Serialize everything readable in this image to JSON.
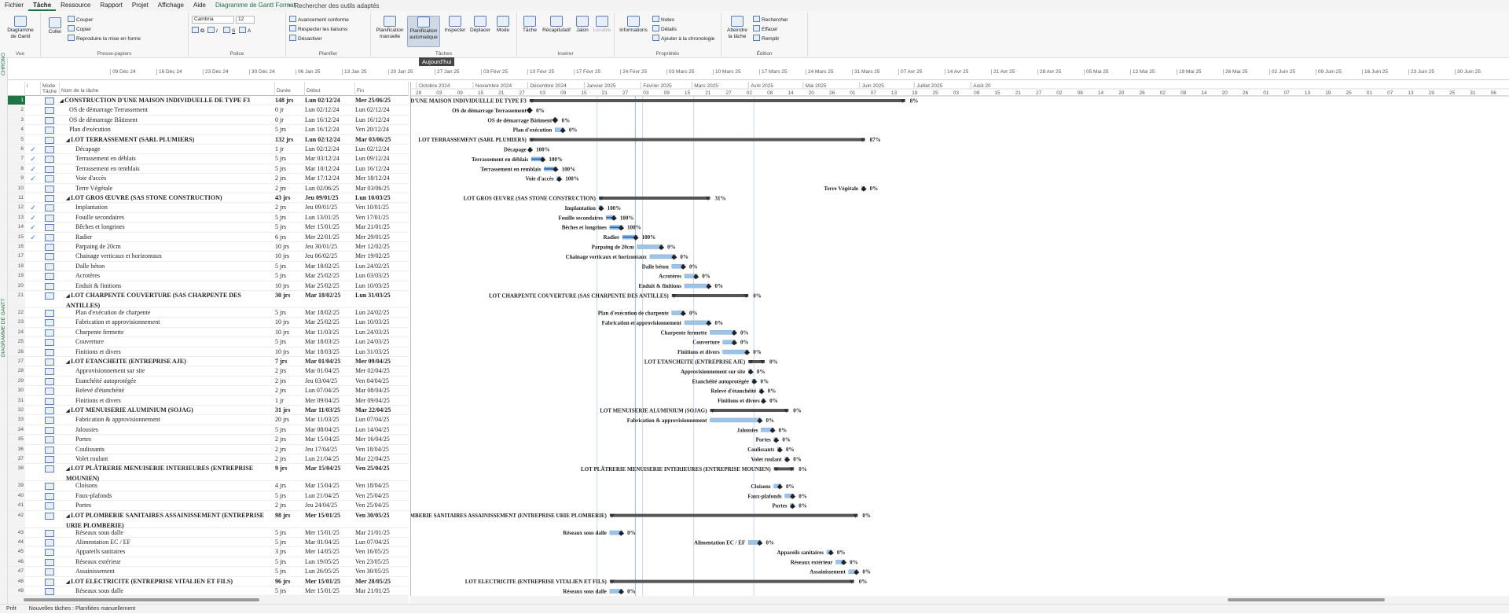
{
  "menu": [
    "Fichier",
    "Tâche",
    "Ressource",
    "Rapport",
    "Projet",
    "Affichage",
    "Aide",
    "Diagramme de Gantt Format"
  ],
  "search_placeholder": "Rechercher des outils adaptés",
  "ribbon": {
    "vue": {
      "label": "Vue",
      "gantt_btn": "Diagramme de Gantt"
    },
    "presse": {
      "label": "Presse-papiers",
      "coller": "Coller",
      "couper": "Couper",
      "copier": "Copier",
      "reproduire": "Reproduire la mise en forme"
    },
    "police": {
      "label": "Police",
      "font": "Cambria",
      "size": "12"
    },
    "planifier": {
      "label": "Planifier",
      "avancement": "Avancement conforme",
      "respecter": "Respecter les liaisons",
      "desactiver": "Désactiver"
    },
    "taches": {
      "label": "Tâches",
      "manuelle": "Planification manuelle",
      "auto": "Planification automatique",
      "inspecter": "Inspecter",
      "deplacer": "Déplacer",
      "mode": "Mode"
    },
    "inserer": {
      "label": "Insérer",
      "tache": "Tâche",
      "recap": "Récapitulatif",
      "jalon": "Jalon",
      "livrable": "Livrable"
    },
    "proprietes": {
      "label": "Propriétés",
      "informations": "Informations",
      "notes": "Notes",
      "details": "Détails",
      "ajouter": "Ajouter à la chronologie"
    },
    "edition": {
      "label": "Édition",
      "atteindre": "Atteindre la tâche",
      "rechercher": "Rechercher",
      "effacer": "Effacer",
      "remplir": "Remplir"
    }
  },
  "today_tooltip": "Aujourd'hui",
  "side_labels": {
    "chrono": "CHRONO",
    "gantt": "DIAGRAMME DE GANTT"
  },
  "timeline_labels": [
    "09 Déc 24",
    "16 Déc 24",
    "23 Déc 24",
    "30 Déc 24",
    "06 Jan 25",
    "13 Jan 25",
    "20 Jan 25",
    "27 Jan 25",
    "03 Févr 25",
    "10 Févr 25",
    "17 Févr 25",
    "24 Févr 25",
    "03 Mars 25",
    "10 Mars 25",
    "17 Mars 25",
    "24 Mars 25",
    "31 Mars 25",
    "07 Avr 25",
    "14 Avr 25",
    "21 Avr 25",
    "28 Avr 25",
    "05 Mai 25",
    "12 Mai 25",
    "19 Mai 25",
    "26 Mai 25",
    "02 Juin 25",
    "09 Juin 25",
    "16 Juin 25",
    "23 Juin 25",
    "30 Juin 25"
  ],
  "columns": {
    "info": "i",
    "mode": "Mode Tâche",
    "name": "Nom de la tâche",
    "dur": "Durée",
    "deb": "Début",
    "fin": "Fin"
  },
  "months": [
    "Octobre 2024",
    "Novembre 2024",
    "Décembre 2024",
    "Janvier 2025",
    "Février 2025",
    "Mars 2025",
    "Avril 2025",
    "Mai 2025",
    "Juin 2025",
    "Juillet 2025",
    "Août 20"
  ],
  "days": [
    "28",
    "03",
    "09",
    "15",
    "21",
    "27",
    "03",
    "09",
    "15",
    "21",
    "27",
    "03",
    "09",
    "15",
    "21",
    "27",
    "02",
    "08",
    "14",
    "20",
    "26",
    "01",
    "07",
    "13",
    "19",
    "25",
    "03",
    "09",
    "15",
    "21",
    "27",
    "02",
    "08",
    "14",
    "20",
    "26",
    "02",
    "08",
    "14",
    "20",
    "26",
    "01",
    "07",
    "13",
    "19",
    "25",
    "01",
    "07",
    "13",
    "19",
    "25",
    "31",
    "06",
    "12"
  ],
  "tasks": [
    {
      "id": "1",
      "name": "CONSTRUCTION D'UNE MAISON INDIVIDUELLE DE TYPE F3",
      "dur": "148 jrs",
      "deb": "Lun 02/12/24",
      "fin": "Mer 25/06/25",
      "summary": true,
      "level": 0,
      "done": "",
      "pct": "8%",
      "label": "CONSTRUCTION D'UNE MAISON INDIVIDUELLE DE TYPE F3"
    },
    {
      "id": "2",
      "name": "OS de démarrage Terrassement",
      "dur": "0 jr",
      "deb": "Lun 02/12/24",
      "fin": "Lun 02/12/24",
      "level": 1,
      "done": "",
      "pct": "0%",
      "label": "OS de démarrage Terrassement"
    },
    {
      "id": "3",
      "name": "OS de démarrage Bâtiment",
      "dur": "0 jr",
      "deb": "Lun 16/12/24",
      "fin": "Lun 16/12/24",
      "level": 1,
      "done": "",
      "pct": "0%",
      "label": "OS de démarrage Bâtiment"
    },
    {
      "id": "4",
      "name": "Plan d'exécution",
      "dur": "5 jrs",
      "deb": "Lun 16/12/24",
      "fin": "Ven 20/12/24",
      "level": 1,
      "done": "",
      "pct": "0%",
      "label": "Plan d'exécution"
    },
    {
      "id": "5",
      "name": "LOT TERRASSEMENT (SARL PLUMIERS)",
      "dur": "132 jrs",
      "deb": "Lun 02/12/24",
      "fin": "Mar 03/06/25",
      "summary": true,
      "level": 1,
      "done": "",
      "pct": "87%",
      "label": "LOT TERRASSEMENT (SARL PLUMIERS)"
    },
    {
      "id": "6",
      "name": "Décapage",
      "dur": "1 jr",
      "deb": "Lun 02/12/24",
      "fin": "Lun 02/12/24",
      "level": 2,
      "done": "✓",
      "pct": "100%",
      "label": "Décapage"
    },
    {
      "id": "7",
      "name": "Terrassement en déblais",
      "dur": "5 jrs",
      "deb": "Mar 03/12/24",
      "fin": "Lun 09/12/24",
      "level": 2,
      "done": "✓",
      "pct": "100%",
      "label": "Terrassement en déblais"
    },
    {
      "id": "8",
      "name": "Terrassement en remblais",
      "dur": "5 jrs",
      "deb": "Mar 10/12/24",
      "fin": "Lun 16/12/24",
      "level": 2,
      "done": "✓",
      "pct": "100%",
      "label": "Terrassement en remblais"
    },
    {
      "id": "9",
      "name": "Voie d'accès",
      "dur": "2 jrs",
      "deb": "Mar 17/12/24",
      "fin": "Mer 18/12/24",
      "level": 2,
      "done": "✓",
      "pct": "100%",
      "label": "Voie d'accès"
    },
    {
      "id": "10",
      "name": "Terre Végétale",
      "dur": "2 jrs",
      "deb": "Lun 02/06/25",
      "fin": "Mar 03/06/25",
      "level": 2,
      "done": "",
      "pct": "0%",
      "label": "Terre Végétale"
    },
    {
      "id": "11",
      "name": "LOT GROS ŒUVRE (SAS STONE CONSTRUCTION)",
      "dur": "43 jrs",
      "deb": "Jeu 09/01/25",
      "fin": "Lun 10/03/25",
      "summary": true,
      "level": 1,
      "done": "",
      "pct": "31%",
      "label": "LOT GROS ŒUVRE (SAS STONE CONSTRUCTION)"
    },
    {
      "id": "12",
      "name": "Implantation",
      "dur": "2 jrs",
      "deb": "Jeu 09/01/25",
      "fin": "Ven 10/01/25",
      "level": 2,
      "done": "✓",
      "pct": "100%",
      "label": "Implantation"
    },
    {
      "id": "13",
      "name": "Fouille secondaires",
      "dur": "5 jrs",
      "deb": "Lun 13/01/25",
      "fin": "Ven 17/01/25",
      "level": 2,
      "done": "✓",
      "pct": "100%",
      "label": "Fouille secondaires"
    },
    {
      "id": "14",
      "name": "Bêches et longrines",
      "dur": "5 jrs",
      "deb": "Mer 15/01/25",
      "fin": "Mar 21/01/25",
      "level": 2,
      "done": "✓",
      "pct": "100%",
      "label": "Bêches et longrines"
    },
    {
      "id": "15",
      "name": "Radier",
      "dur": "6 jrs",
      "deb": "Mer 22/01/25",
      "fin": "Mer 29/01/25",
      "level": 2,
      "done": "✓",
      "pct": "100%",
      "label": "Radier"
    },
    {
      "id": "16",
      "name": "Parpaing de 20cm",
      "dur": "10 jrs",
      "deb": "Jeu 30/01/25",
      "fin": "Mer 12/02/25",
      "level": 2,
      "done": "",
      "pct": "0%",
      "label": "Parpaing de 20cm"
    },
    {
      "id": "17",
      "name": "Chainage verticaux et horizontaux",
      "dur": "10 jrs",
      "deb": "Jeu 06/02/25",
      "fin": "Mer 19/02/25",
      "level": 2,
      "done": "",
      "pct": "0%",
      "label": "Chainage verticaux et horizontaux"
    },
    {
      "id": "18",
      "name": "Dalle béton",
      "dur": "5 jrs",
      "deb": "Mar 18/02/25",
      "fin": "Lun 24/02/25",
      "level": 2,
      "done": "",
      "pct": "0%",
      "label": "Dalle béton"
    },
    {
      "id": "19",
      "name": "Acrotères",
      "dur": "5 jrs",
      "deb": "Mar 25/02/25",
      "fin": "Lun 03/03/25",
      "level": 2,
      "done": "",
      "pct": "0%",
      "label": "Acrotères"
    },
    {
      "id": "20",
      "name": "Enduit & finitions",
      "dur": "10 jrs",
      "deb": "Mar 25/02/25",
      "fin": "Lun 10/03/25",
      "level": 2,
      "done": "",
      "pct": "0%",
      "label": "Enduit & finitions"
    },
    {
      "id": "21",
      "name": "LOT CHARPENTE COUVERTURE (SAS CHARPENTE DES ANTILLES)",
      "dur": "30 jrs",
      "deb": "Mar 18/02/25",
      "fin": "Lun 31/03/25",
      "summary": true,
      "level": 1,
      "done": "",
      "pct": "0%",
      "label": "LOT CHARPENTE COUVERTURE (SAS CHARPENTE DES ANTILLES)",
      "tall": true
    },
    {
      "id": "22",
      "name": "Plan d'exécution de charpente",
      "dur": "5 jrs",
      "deb": "Mar 18/02/25",
      "fin": "Lun 24/02/25",
      "level": 2,
      "done": "",
      "pct": "0%",
      "label": "Plan d'exécution de charpente"
    },
    {
      "id": "23",
      "name": "Fabrication et approvisionnement",
      "dur": "10 jrs",
      "deb": "Mar 25/02/25",
      "fin": "Lun 10/03/25",
      "level": 2,
      "done": "",
      "pct": "0%",
      "label": "Fabrication et approvisionnement"
    },
    {
      "id": "24",
      "name": "Charpente fermette",
      "dur": "10 jrs",
      "deb": "Mar 11/03/25",
      "fin": "Lun 24/03/25",
      "level": 2,
      "done": "",
      "pct": "0%",
      "label": "Charpente fermette"
    },
    {
      "id": "25",
      "name": "Couverture",
      "dur": "5 jrs",
      "deb": "Mar 18/03/25",
      "fin": "Lun 24/03/25",
      "level": 2,
      "done": "",
      "pct": "0%",
      "label": "Couverture"
    },
    {
      "id": "26",
      "name": "Finitions et divers",
      "dur": "10 jrs",
      "deb": "Mar 18/03/25",
      "fin": "Lun 31/03/25",
      "level": 2,
      "done": "",
      "pct": "0%",
      "label": "Finitions et divers"
    },
    {
      "id": "27",
      "name": "LOT ETANCHEITE (ENTREPRISE AJE)",
      "dur": "7 jrs",
      "deb": "Mar 01/04/25",
      "fin": "Mer 09/04/25",
      "summary": true,
      "level": 1,
      "done": "",
      "pct": "0%",
      "label": "LOT ETANCHEITE (ENTREPRISE AJE)"
    },
    {
      "id": "28",
      "name": "Approvisionnement sur site",
      "dur": "2 jrs",
      "deb": "Mar 01/04/25",
      "fin": "Mer 02/04/25",
      "level": 2,
      "done": "",
      "pct": "0%",
      "label": "Approvisionnement sur site"
    },
    {
      "id": "29",
      "name": "Etanchéité autoprotégée",
      "dur": "2 jrs",
      "deb": "Jeu 03/04/25",
      "fin": "Ven 04/04/25",
      "level": 2,
      "done": "",
      "pct": "0%",
      "label": "Etanchéité autoprotégée"
    },
    {
      "id": "30",
      "name": "Relevé d'étanchéité",
      "dur": "2 jrs",
      "deb": "Lun 07/04/25",
      "fin": "Mar 08/04/25",
      "level": 2,
      "done": "",
      "pct": "0%",
      "label": "Relevé d'étanchéité"
    },
    {
      "id": "31",
      "name": "Finitions et divers",
      "dur": "1 jr",
      "deb": "Mer 09/04/25",
      "fin": "Mer 09/04/25",
      "level": 2,
      "done": "",
      "pct": "0%",
      "label": "Finitions et divers"
    },
    {
      "id": "32",
      "name": "LOT MENUISERIE ALUMINIUM (SOJAG)",
      "dur": "31 jrs",
      "deb": "Mar 11/03/25",
      "fin": "Mar 22/04/25",
      "summary": true,
      "level": 1,
      "done": "",
      "pct": "0%",
      "label": "LOT MENUISERIE ALUMINIUM (SOJAG)"
    },
    {
      "id": "33",
      "name": "Fabrication & approvisionnement",
      "dur": "20 jrs",
      "deb": "Mar 11/03/25",
      "fin": "Lun 07/04/25",
      "level": 2,
      "done": "",
      "pct": "0%",
      "label": "Fabrication & approvisionnement"
    },
    {
      "id": "34",
      "name": "Jalousies",
      "dur": "5 jrs",
      "deb": "Mar 08/04/25",
      "fin": "Lun 14/04/25",
      "level": 2,
      "done": "",
      "pct": "0%",
      "label": "Jalousies"
    },
    {
      "id": "35",
      "name": "Portes",
      "dur": "2 jrs",
      "deb": "Mar 15/04/25",
      "fin": "Mer 16/04/25",
      "level": 2,
      "done": "",
      "pct": "0%",
      "label": "Portes"
    },
    {
      "id": "36",
      "name": "Coulissants",
      "dur": "2 jrs",
      "deb": "Jeu 17/04/25",
      "fin": "Ven 18/04/25",
      "level": 2,
      "done": "",
      "pct": "0%",
      "label": "Coulissants"
    },
    {
      "id": "37",
      "name": "Volet roulant",
      "dur": "2 jrs",
      "deb": "Lun 21/04/25",
      "fin": "Mar 22/04/25",
      "level": 2,
      "done": "",
      "pct": "0%",
      "label": "Volet roulant"
    },
    {
      "id": "38",
      "name": "LOT PLÂTRERIE MENUISERIE INTERIEURES (ENTREPRISE MOUNIEN)",
      "dur": "9 jrs",
      "deb": "Mar 15/04/25",
      "fin": "Ven 25/04/25",
      "summary": true,
      "level": 1,
      "done": "",
      "pct": "0%",
      "label": "LOT PLÂTRERIE MENUISERIE INTERIEURES (ENTREPRISE MOUNIEN)",
      "tall": true
    },
    {
      "id": "39",
      "name": "Cloisons",
      "dur": "4 jrs",
      "deb": "Mar 15/04/25",
      "fin": "Ven 18/04/25",
      "level": 2,
      "done": "",
      "pct": "0%",
      "label": "Cloisons"
    },
    {
      "id": "40",
      "name": "Faux-plafonds",
      "dur": "5 jrs",
      "deb": "Lun 21/04/25",
      "fin": "Ven 25/04/25",
      "level": 2,
      "done": "",
      "pct": "0%",
      "label": "Faux-plafonds"
    },
    {
      "id": "41",
      "name": "Portes",
      "dur": "2 jrs",
      "deb": "Jeu 24/04/25",
      "fin": "Ven 25/04/25",
      "level": 2,
      "done": "",
      "pct": "0%",
      "label": "Portes"
    },
    {
      "id": "42",
      "name": "LOT PLOMBERIE SANITAIRES ASSAINISSEMENT (ENTREPRISE URIE PLOMBERIE)",
      "dur": "98 jrs",
      "deb": "Mer 15/01/25",
      "fin": "Ven 30/05/25",
      "summary": true,
      "level": 1,
      "done": "",
      "pct": "0%",
      "label": "LOT PLOMBERIE SANITAIRES ASSAINISSEMENT (ENTREPRISE URIE PLOMBERIE)",
      "tall": true
    },
    {
      "id": "43",
      "name": "Réseaux sous dalle",
      "dur": "5 jrs",
      "deb": "Mer 15/01/25",
      "fin": "Mar 21/01/25",
      "level": 2,
      "done": "",
      "pct": "0%",
      "label": "Réseaux sous dalle"
    },
    {
      "id": "44",
      "name": "Alimentation EC / EF",
      "dur": "5 jrs",
      "deb": "Mar 01/04/25",
      "fin": "Lun 07/04/25",
      "level": 2,
      "done": "",
      "pct": "0%",
      "label": "Alimentation EC / EF"
    },
    {
      "id": "45",
      "name": "Appareils sanitaires",
      "dur": "3 jrs",
      "deb": "Mer 14/05/25",
      "fin": "Ven 16/05/25",
      "level": 2,
      "done": "",
      "pct": "0%",
      "label": "Appareils sanitaires"
    },
    {
      "id": "46",
      "name": "Réseaux extérieur",
      "dur": "5 jrs",
      "deb": "Lun 19/05/25",
      "fin": "Ven 23/05/25",
      "level": 2,
      "done": "",
      "pct": "0%",
      "label": "Réseaux extérieur"
    },
    {
      "id": "47",
      "name": "Assainissement",
      "dur": "5 jrs",
      "deb": "Lun 26/05/25",
      "fin": "Ven 30/05/25",
      "level": 2,
      "done": "",
      "pct": "0%",
      "label": "Assainissement"
    },
    {
      "id": "48",
      "name": "LOT ELECTRICITE (ENTREPRISE VITALIEN ET FILS)",
      "dur": "96 jrs",
      "deb": "Mer 15/01/25",
      "fin": "Mer 28/05/25",
      "summary": true,
      "level": 1,
      "done": "",
      "pct": "0%",
      "label": "LOT ELECTRICITE (ENTREPRISE VITALIEN ET FILS)"
    },
    {
      "id": "49",
      "name": "Réseaux sous dalle",
      "dur": "5 jrs",
      "deb": "Mer 15/01/25",
      "fin": "Mar 21/01/25",
      "level": 2,
      "done": "",
      "pct": "0%",
      "label": "Réseaux sous dalle"
    }
  ],
  "status": {
    "pret": "Prêt",
    "nouvelles": "Nouvelles tâches : Planifiées manuellement"
  }
}
